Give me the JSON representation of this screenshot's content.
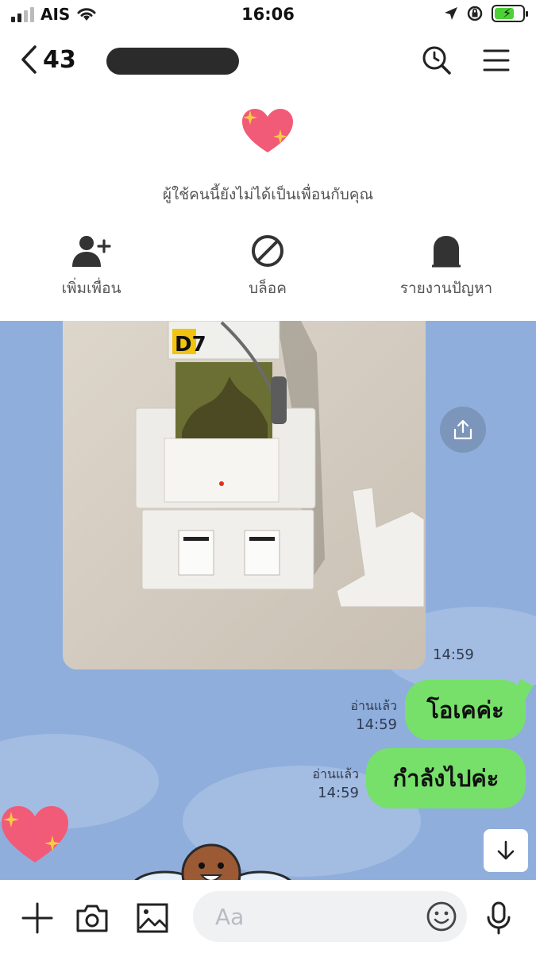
{
  "status_bar": {
    "carrier": "AIS",
    "time": "16:06",
    "battery_percent": 70,
    "icons": [
      "signal-icon",
      "wifi-icon",
      "location-icon",
      "orientation-lock-icon",
      "battery-charging-icon"
    ]
  },
  "header": {
    "back_count": "43",
    "icons": [
      "back-chevron-icon",
      "search-history-icon",
      "menu-icon"
    ]
  },
  "banner": {
    "notice": "ผู้ใช้คนนี้ยังไม่ได้เป็นเพื่อนกับคุณ",
    "add_friend": "เพิ่มเพื่อน",
    "block": "บล็อค",
    "report": "รายงานปัญหา"
  },
  "chat": {
    "background": "#8faedc",
    "photo_time": "14:59",
    "messages": [
      {
        "text": "โอเคค่ะ",
        "status": "อ่านแล้ว",
        "time": "14:59"
      },
      {
        "text": "กำลังไปค่ะ",
        "status": "อ่านแล้ว",
        "time": "14:59"
      }
    ],
    "bubble_color": "#76e06a"
  },
  "photo": {
    "label_card": "D7"
  },
  "input": {
    "placeholder": "Aa"
  }
}
